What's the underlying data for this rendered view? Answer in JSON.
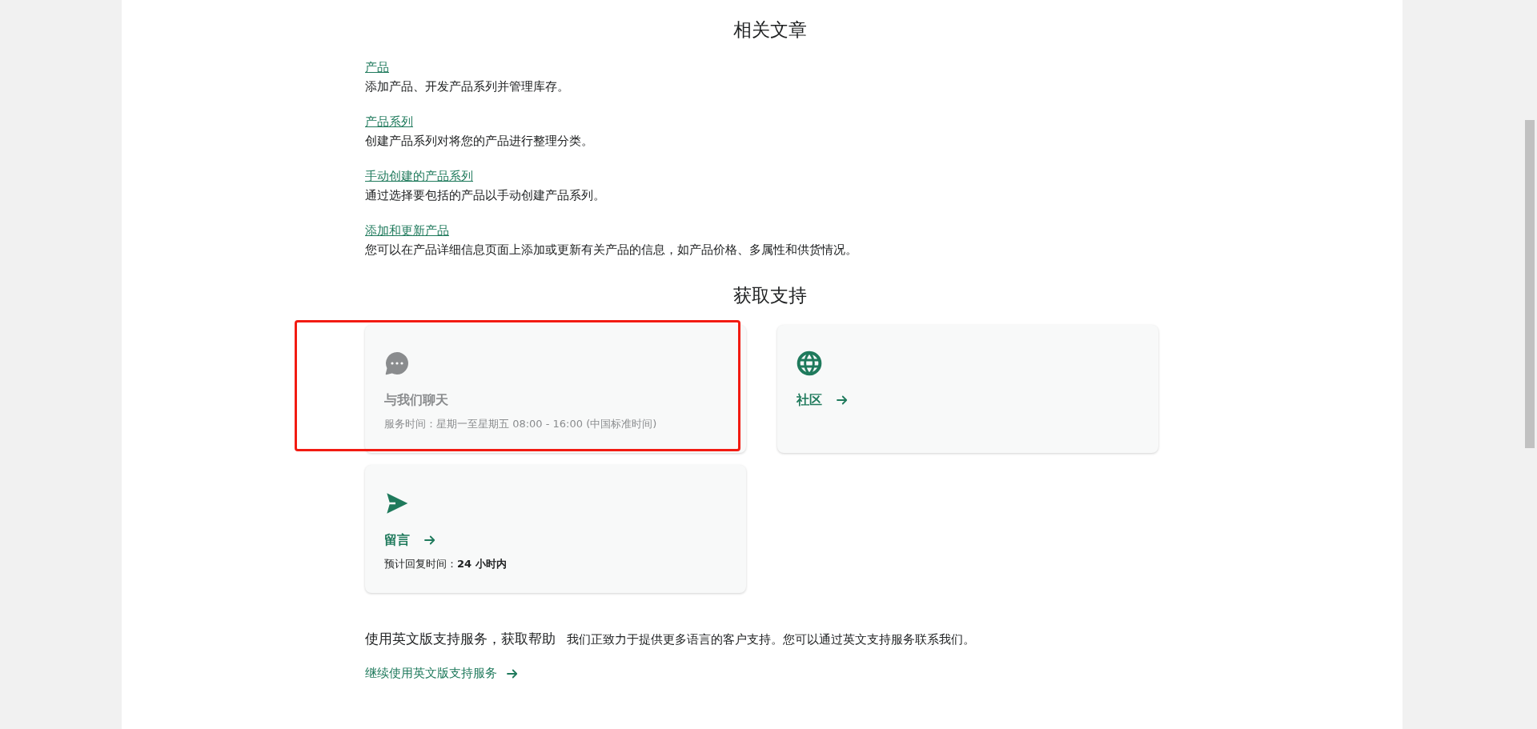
{
  "related": {
    "title": "相关文章",
    "articles": [
      {
        "link": "产品",
        "description": "添加产品、开发产品系列并管理库存。"
      },
      {
        "link": "产品系列",
        "description": "创建产品系列对将您的产品进行整理分类。"
      },
      {
        "link": "手动创建的产品系列",
        "description": "通过选择要包括的产品以手动创建产品系列。"
      },
      {
        "link": "添加和更新产品",
        "description": "您可以在产品详细信息页面上添加或更新有关产品的信息，如产品价格、多属性和供货情况。"
      }
    ]
  },
  "support": {
    "title": "获取支持",
    "cards": [
      {
        "kind": "chat",
        "title": "与我们聊天",
        "detail": "服务时间：星期一至星期五 08:00 - 16:00 (中国标准时间)",
        "disabled": true,
        "highlighted": true
      },
      {
        "kind": "community",
        "title": "社区",
        "disabled": false,
        "highlighted": false
      },
      {
        "kind": "message",
        "title": "留言",
        "detail": "预计回复时间：**24 小时内**",
        "disabled": false,
        "highlighted": false
      }
    ]
  },
  "english": {
    "heading": "使用英文版支持服务，获取帮助",
    "text": "我们正致力于提供更多语言的客户支持。您可以通过英文支持服务联系我们。",
    "link": "继续使用英文版支持服务"
  }
}
